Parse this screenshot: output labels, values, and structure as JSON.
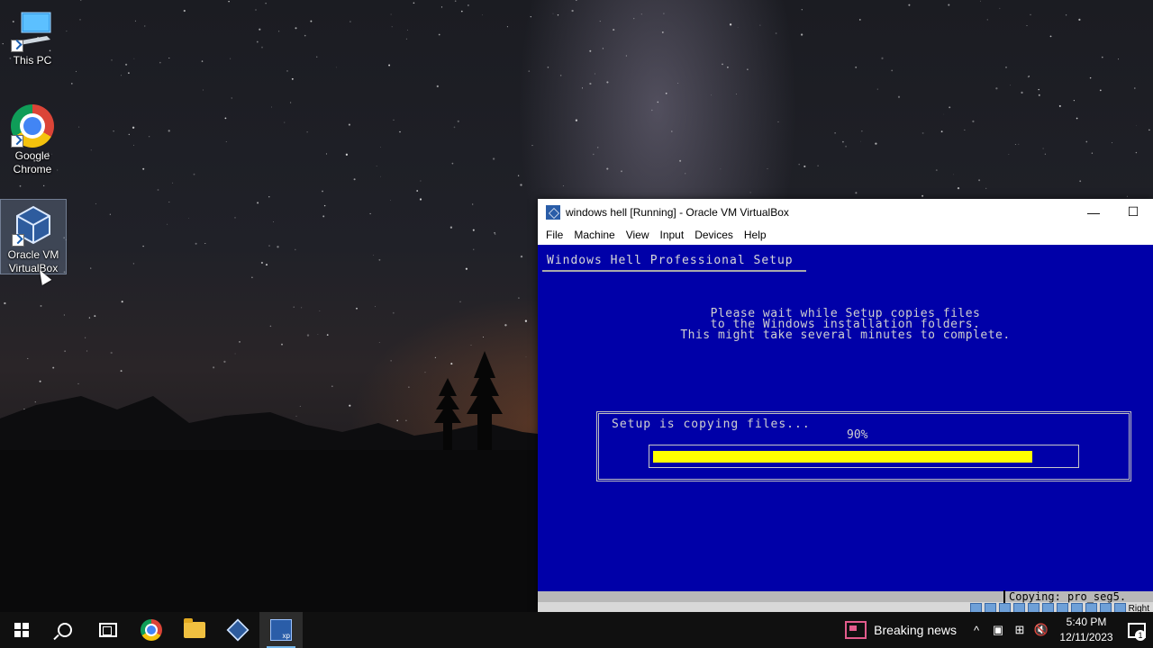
{
  "desktop": {
    "icons": [
      {
        "label": "This PC",
        "icon": "computer-icon"
      },
      {
        "label": "Google\nChrome",
        "icon": "chrome-icon"
      },
      {
        "label": "Oracle VM\nVirtualBox",
        "icon": "virtualbox-icon"
      }
    ]
  },
  "vbox_window": {
    "title": "windows hell [Running] - Oracle VM VirtualBox",
    "minimize_glyph": "—",
    "maximize_glyph": "☐",
    "menu": [
      "File",
      "Machine",
      "View",
      "Input",
      "Devices",
      "Help"
    ]
  },
  "vm_screen": {
    "header": "Windows Hell Professional Setup",
    "wait_lines": [
      "Please wait while Setup copies files",
      "to the Windows installation folders.",
      "This might take several minutes to complete."
    ],
    "copy_label": "Setup is copying files...",
    "percent_text": "90%",
    "progress_fraction": 0.9,
    "status": "Copying: pro_seg5.",
    "host_key": "Right"
  },
  "taskbar": {
    "news": "Breaking news",
    "time": "5:40 PM",
    "date": "12/11/2023",
    "notification_count": "1",
    "tray_up_glyph": "^",
    "volume_glyph": "🔇"
  },
  "colors": {
    "vm_background": "#0000a8",
    "progress_fill": "#ffff00",
    "taskbar": "#101010"
  }
}
